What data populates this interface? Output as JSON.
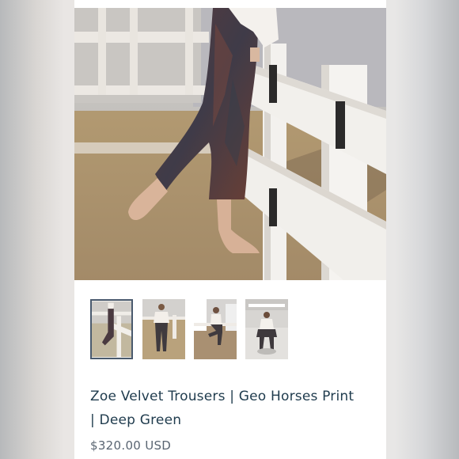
{
  "product": {
    "title_line1": "Zoe Velvet Trousers | Geo Horses Print",
    "title_line2": "| Deep Green",
    "price": "$320.00 USD"
  },
  "gallery": {
    "main_image": "model-sitting-on-white-fence-photo",
    "thumbnails": [
      {
        "name": "thumbnail-1",
        "selected": true
      },
      {
        "name": "thumbnail-2",
        "selected": false
      },
      {
        "name": "thumbnail-3",
        "selected": false
      },
      {
        "name": "thumbnail-4",
        "selected": false
      }
    ]
  },
  "colors": {
    "title": "#1f3b4d",
    "price": "#5a6572",
    "selected_border": "#4a5a6e"
  }
}
